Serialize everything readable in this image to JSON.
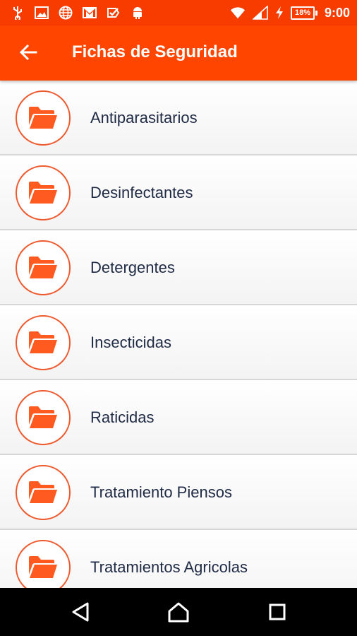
{
  "status_bar": {
    "battery_percent": "18%",
    "time": "9:00",
    "icons": [
      "usb-icon",
      "image-icon",
      "globe-icon",
      "gmail-icon",
      "check-shield-icon",
      "android-icon",
      "wifi-icon",
      "signal-icon",
      "charging-icon",
      "battery-icon"
    ]
  },
  "header": {
    "title": "Fichas de Seguridad",
    "back_icon": "arrow-left-icon"
  },
  "list": {
    "items": [
      {
        "label": "Antiparasitarios",
        "icon": "folder-icon"
      },
      {
        "label": "Desinfectantes",
        "icon": "folder-icon"
      },
      {
        "label": "Detergentes",
        "icon": "folder-icon"
      },
      {
        "label": "Insecticidas",
        "icon": "folder-icon"
      },
      {
        "label": "Raticidas",
        "icon": "folder-icon"
      },
      {
        "label": "Tratamiento Piensos",
        "icon": "folder-icon"
      },
      {
        "label": "Tratamientos Agricolas",
        "icon": "folder-icon"
      }
    ]
  },
  "nav_bar": {
    "icons": [
      "back-triangle-icon",
      "home-icon",
      "recents-icon"
    ]
  },
  "colors": {
    "status_bar": "#f83c00",
    "app_bar": "#ff4500",
    "folder": "#ff5a1f",
    "label_text": "#1f2a44"
  }
}
